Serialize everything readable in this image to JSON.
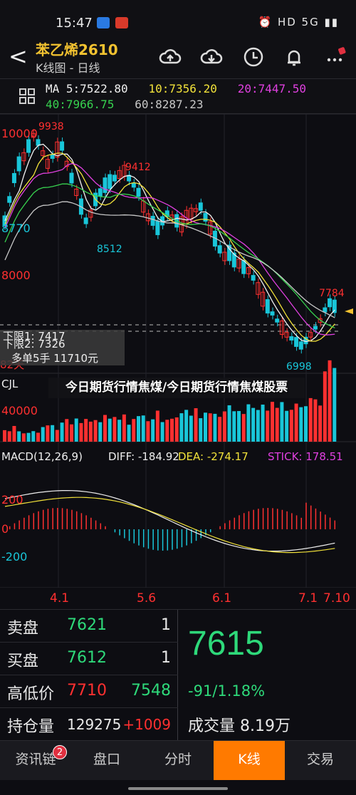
{
  "status": {
    "time": "15:47",
    "right": "⏰ HD 5G ▮▮"
  },
  "header": {
    "back": "<",
    "title": "苯乙烯2610",
    "subtitle": "K线图 - 日线"
  },
  "ma": {
    "ma5": "MA 5:7522.80",
    "ma10": "10:7356.20",
    "ma20": "20:7447.50",
    "ma40": "40:7966.75",
    "ma60": "60:8287.23",
    "colors": {
      "ma5": "#f0f0f0",
      "ma10": "#f2e23a",
      "ma20": "#e040e0",
      "ma40": "#37d24f",
      "ma60": "#c8c8c8"
    }
  },
  "chart": {
    "price_labels": [
      "10000",
      "8770",
      "8000",
      "82天"
    ],
    "high_label": "9938",
    "mid_high_label": "9412",
    "low_mid_label": "8512",
    "right_high_label": "7784",
    "low_label": "6998",
    "cjl_label": "CJL",
    "cjl_value": "40000",
    "macd_title": "MACD(12,26,9)",
    "diff": "DIFF: -184.92",
    "dea": "DEA: -274.17",
    "stick": "STICK: 178.51",
    "macd_ticks": [
      "200",
      "0",
      "-200"
    ],
    "dates": [
      "4.1",
      "5.6",
      "6.1",
      "7.1",
      "7.10"
    ],
    "up_color": "#ff3030",
    "down_color": "#19c6d9"
  },
  "overlay": {
    "upper": "下限1: 7417",
    "lower": "下限2: 7326",
    "order": "多单5手  11710元"
  },
  "headline": "今日期货行情焦煤/今日期货行情焦煤股票",
  "quote": {
    "sell_label": "卖盘",
    "sell_price": "7621",
    "sell_qty": "1",
    "buy_label": "买盘",
    "buy_price": "7612",
    "buy_qty": "1",
    "hl_label": "高低价",
    "high": "7710",
    "low": "7548",
    "oi_label": "持仓量",
    "oi": "129275",
    "oi_change": "+1009",
    "last": "7615",
    "change": "-91/1.18%",
    "volume": "成交量 8.19万"
  },
  "tabs": [
    "资讯链",
    "盘口",
    "分时",
    "K线",
    "交易"
  ],
  "tab_badge": "2"
}
